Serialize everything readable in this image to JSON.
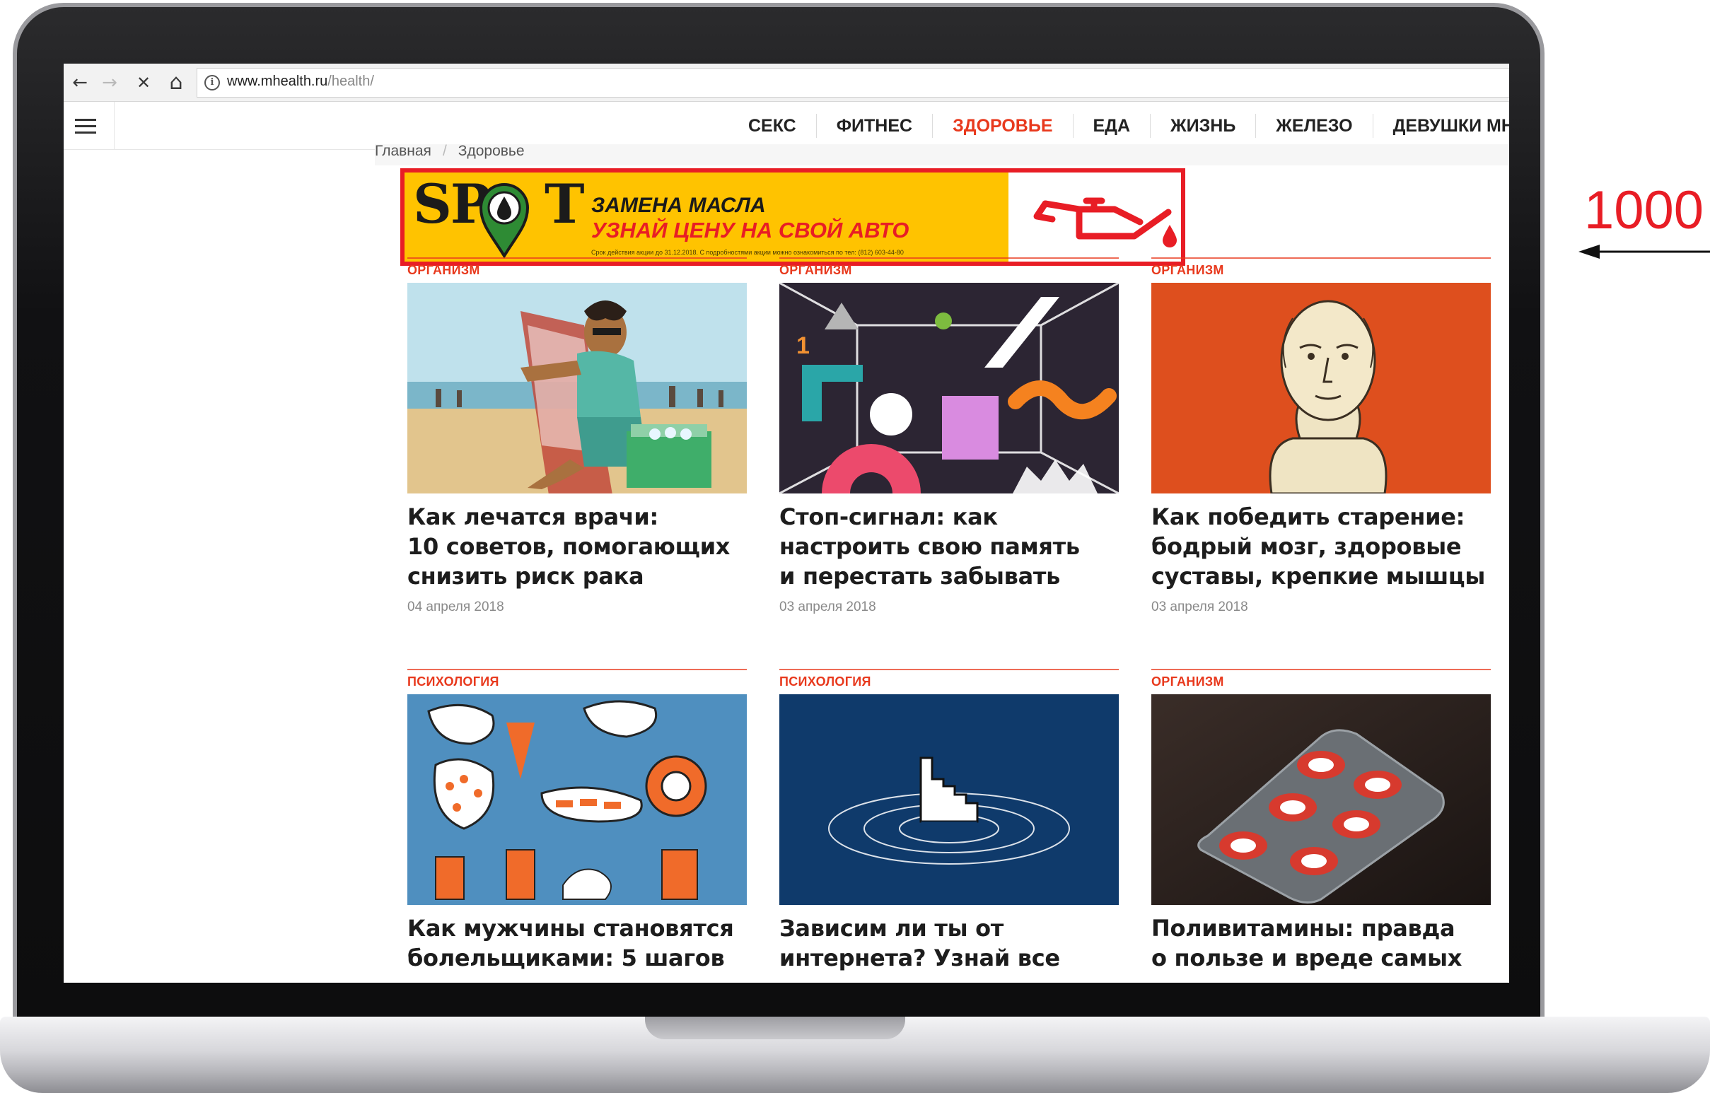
{
  "browser": {
    "back_icon": "←",
    "forward_icon": "→",
    "stop_icon": "✕",
    "home_icon": "⌂",
    "info_icon": "i",
    "url_host": "www.mhealth.ru",
    "url_path": "/health/"
  },
  "header": {
    "nav": [
      "СЕКС",
      "ФИТНЕС",
      "ЗДОРОВЬЕ",
      "ЕДА",
      "ЖИЗНЬ",
      "ЖЕЛЕЗО",
      "ДЕВУШКИ МН"
    ],
    "active_index": 2
  },
  "breadcrumb": {
    "home": "Главная",
    "separator": "/",
    "current": "Здоровье"
  },
  "ad": {
    "logo": "SP",
    "logo_tail": "T",
    "title": "ЗАМЕНА МАСЛА",
    "subtitle": "УЗНАЙ ЦЕНУ НА СВОЙ АВТО",
    "fine_print": "Срок действия акции до 31.12.2018. С подробностями акции можно ознакомиться по тел: (812) 603-44-80",
    "colors": {
      "background": "#ffc300",
      "border": "#e81d25",
      "accent": "#e81d25"
    }
  },
  "articles": [
    {
      "category": "ОРГАНИЗМ",
      "title": "Как лечатся врачи:\n10 советов, помогающих\nснизить риск рака",
      "date": "04 апреля 2018"
    },
    {
      "category": "ОРГАНИЗМ",
      "title": "Стоп-сигнал: как\nнастроить свою память\nи перестать забывать",
      "date": "03 апреля 2018"
    },
    {
      "category": "ОРГАНИЗМ",
      "title": "Как победить старение:\nбодрый мозг, здоровые\nсуставы, крепкие мышцы",
      "date": "03 апреля 2018"
    },
    {
      "category": "ПСИХОЛОГИЯ",
      "title": "Как мужчины становятся\nболельщиками: 5 шагов",
      "date": ""
    },
    {
      "category": "ПСИХОЛОГИЯ",
      "title": "Зависим ли ты от\nинтернета? Узнай все",
      "date": ""
    },
    {
      "category": "ОРГАНИЗМ",
      "title": "Поливитамины: правда\nо пользе и вреде самых",
      "date": ""
    }
  ],
  "annotation": {
    "label": "1000",
    "color": "#e81d25"
  },
  "colors": {
    "accent": "#e8391d",
    "text": "#1d1d1d",
    "muted": "#8a8a8a"
  }
}
